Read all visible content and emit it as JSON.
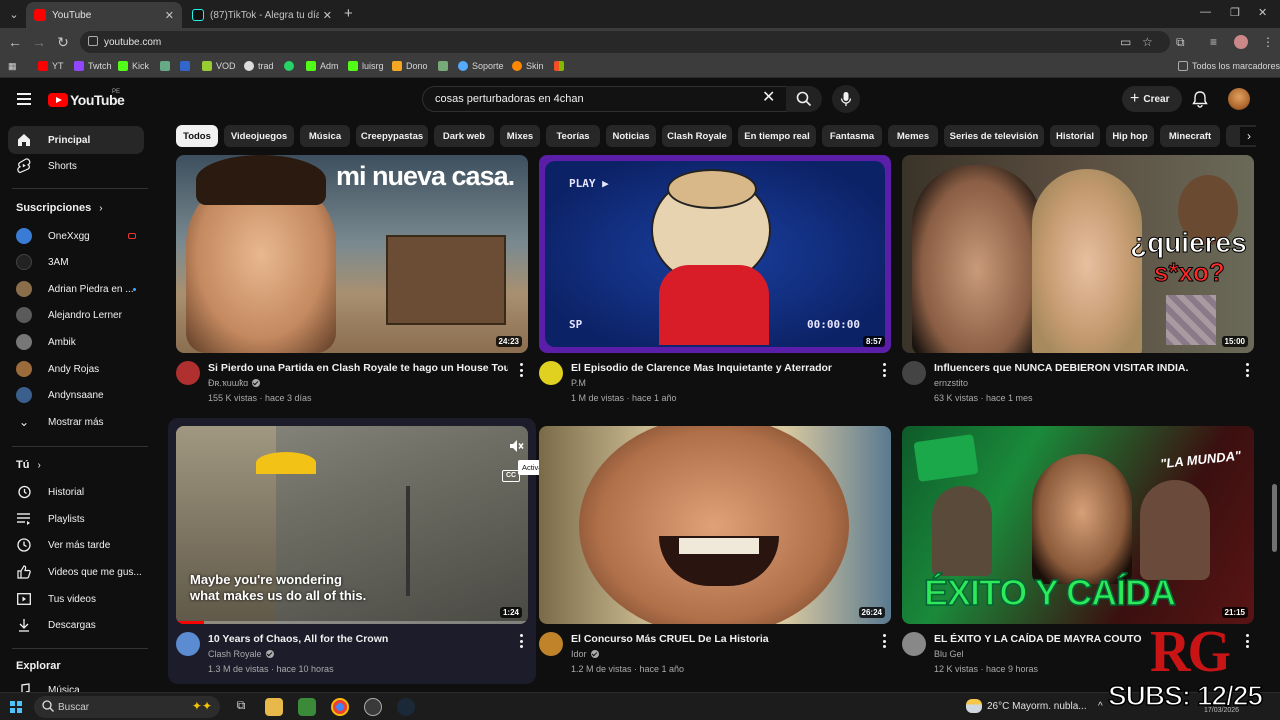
{
  "browser": {
    "tabs": [
      {
        "title": "YouTube",
        "active": true
      },
      {
        "title": "(87)TikTok - Alegra tu día",
        "active": false
      }
    ],
    "url": "youtube.com",
    "bookmarks": [
      "YT",
      "Twtch",
      "Kick",
      "",
      "",
      "VOD",
      "trad",
      "",
      "Adm",
      "luisrg",
      "Dono",
      "",
      "Soporte",
      "Skin",
      ""
    ],
    "all_bookmarks": "Todos los marcadores"
  },
  "header": {
    "logo": "YouTube",
    "logo_region": "PE",
    "search_value": "cosas perturbadoras en 4chan",
    "create_label": "Crear"
  },
  "sidebar": {
    "main": [
      {
        "label": "Principal",
        "icon": "home-icon",
        "active": true
      },
      {
        "label": "Shorts",
        "icon": "shorts-icon"
      }
    ],
    "subs_heading": "Suscripciones",
    "subscriptions": [
      {
        "label": "OneXxgg",
        "color": "#3a7bd5",
        "badge": "live"
      },
      {
        "label": "3AM",
        "color": "#222222"
      },
      {
        "label": "Adrian Piedra en ...",
        "color": "#8a6d4b",
        "badge": "new"
      },
      {
        "label": "Alejandro Lerner",
        "color": "#5a5a5a"
      },
      {
        "label": "Ambik",
        "color": "#777777"
      },
      {
        "label": "Andy Rojas",
        "color": "#9c6b3b"
      },
      {
        "label": "Andynsaane",
        "color": "#3b5f8c"
      }
    ],
    "show_more": "Mostrar más",
    "you_heading": "Tú",
    "you_items": [
      {
        "label": "Historial",
        "icon": "history-icon"
      },
      {
        "label": "Playlists",
        "icon": "playlists-icon"
      },
      {
        "label": "Ver más tarde",
        "icon": "watch-later-icon"
      },
      {
        "label": "Videos que me gus...",
        "icon": "like-icon"
      },
      {
        "label": "Tus videos",
        "icon": "your-videos-icon"
      },
      {
        "label": "Descargas",
        "icon": "downloads-icon"
      }
    ],
    "explore_heading": "Explorar",
    "explore_items": [
      {
        "label": "Música",
        "icon": "music-icon"
      }
    ]
  },
  "chips": [
    "Todos",
    "Videojuegos",
    "Música",
    "Creepypastas",
    "Dark web",
    "Mixes",
    "Teorías",
    "Noticias",
    "Clash Royale",
    "En tiempo real",
    "Fantasma",
    "Memes",
    "Series de televisión",
    "Historial",
    "Hip hop",
    "Minecraft"
  ],
  "videos": [
    {
      "title": "Si Pierdo una Partida en Clash Royale te hago un House Tour!",
      "channel": "Ɖʀ.ҡuɯҟɑ",
      "verified": true,
      "stats": "155 K vistas · hace 3 días",
      "duration": "24:23",
      "thumb_text": "mi nueva casa.",
      "avatar_color": "#b03030"
    },
    {
      "title": "El Episodio de Clarence Mas Inquietante y Aterrador",
      "channel": "P.M",
      "verified": false,
      "stats": "1 M de vistas · hace 1 año",
      "duration": "8:57",
      "thumb_text": "PLAY ▶",
      "thumb_sp": "SP",
      "thumb_time": "00:00:00",
      "avatar_color": "#e0d020"
    },
    {
      "title": "Influencers que NUNCA DEBIERON VISITAR INDIA.",
      "channel": "ernzstito",
      "verified": false,
      "stats": "63 K vistas · hace 1 mes",
      "duration": "15:00",
      "thumb_text": "¿quieres",
      "thumb_text2": "s*xo?",
      "avatar_color": "#444444"
    },
    {
      "title": "10 Years of Chaos, All for the Crown",
      "channel": "Clash Royale",
      "verified": true,
      "stats": "1.3 M de vistas · hace 10 horas",
      "duration": "1:24",
      "thumb_caption_1": "Maybe you're wondering",
      "thumb_caption_2": "what makes us do all of this.",
      "tooltip": "Activar sonido",
      "avatar_color": "#5b8bd0"
    },
    {
      "title": "El Concurso Más CRUEL De La Historia",
      "channel": "Idor",
      "verified": true,
      "stats": "1.2 M de vistas · hace 1 año",
      "duration": "26:24",
      "avatar_color": "#c0832a"
    },
    {
      "title": "EL ÉXITO Y LA CAÍDA DE MAYRA COUTO",
      "channel": "Blu Gel",
      "verified": false,
      "stats": "12 K vistas · hace 9 horas",
      "duration": "21:15",
      "thumb_text": "ÉXITO Y CAÍDA",
      "thumb_quote": "\"LA MUNDA\"",
      "avatar_color": "#888888"
    }
  ],
  "taskbar": {
    "search": "Buscar",
    "weather": "26°C  Mayorm. nubla...",
    "date": "17/03/2026"
  },
  "overlay": {
    "logo": "RG",
    "subs": "SUBS: 12/25"
  }
}
